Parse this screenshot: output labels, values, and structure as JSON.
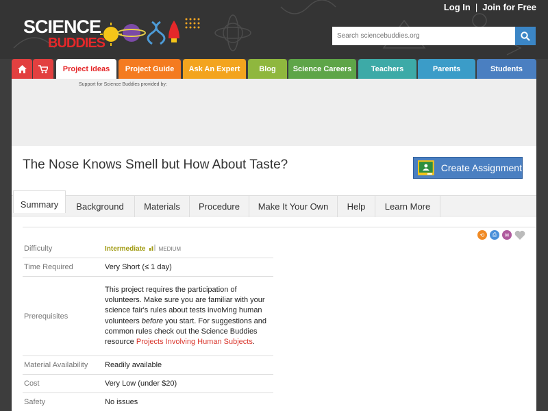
{
  "header": {
    "log_in": "Log In",
    "separator": "|",
    "join": "Join for Free",
    "logo_line1": "SCIENCE",
    "logo_line2": "BUDDIES",
    "search_placeholder": "Search sciencebuddies.org"
  },
  "nav": {
    "items": [
      {
        "label": "",
        "icon": "home-icon",
        "color": "#e24040"
      },
      {
        "label": "",
        "icon": "cart-icon",
        "color": "#e24040"
      },
      {
        "label": "Project Ideas",
        "color": "#e5282a"
      },
      {
        "label": "Project Guide",
        "color": "#f47b20"
      },
      {
        "label": "Ask An Expert",
        "color": "#f3a41e"
      },
      {
        "label": "Blog",
        "color": "#8fb73e"
      },
      {
        "label": "Science Careers",
        "color": "#5ea548"
      },
      {
        "label": "Teachers",
        "color": "#3daaa7"
      },
      {
        "label": "Parents",
        "color": "#3b9cc8"
      },
      {
        "label": "Students",
        "color": "#4a7fc1"
      }
    ]
  },
  "ad": {
    "label": "Support for Science Buddies provided by:"
  },
  "page": {
    "title": "The Nose Knows Smell but How About Taste?",
    "create_assignment": "Create Assignment"
  },
  "tabs": [
    "Summary",
    "Background",
    "Materials",
    "Procedure",
    "Make It Your Own",
    "Help",
    "Learn More"
  ],
  "summary": {
    "difficulty_label": "Difficulty",
    "difficulty_level": "Intermediate",
    "difficulty_scale": "MEDIUM",
    "time_label": "Time Required",
    "time_value": "Very Short (≤ 1 day)",
    "prereq_label": "Prerequisites",
    "prereq_part1": "This project requires the participation of volunteers. Make sure you are familiar with your science fair's rules about tests involving human volunteers ",
    "prereq_italic": "before",
    "prereq_part2": " you start. For suggestions and common rules check out the Science Buddies resource ",
    "prereq_link": "Projects Involving Human Subjects",
    "prereq_end": ".",
    "material_label": "Material Availability",
    "material_value": "Readily available",
    "cost_label": "Cost",
    "cost_value": "Very Low (under $20)",
    "safety_label": "Safety",
    "safety_value": "No issues"
  }
}
